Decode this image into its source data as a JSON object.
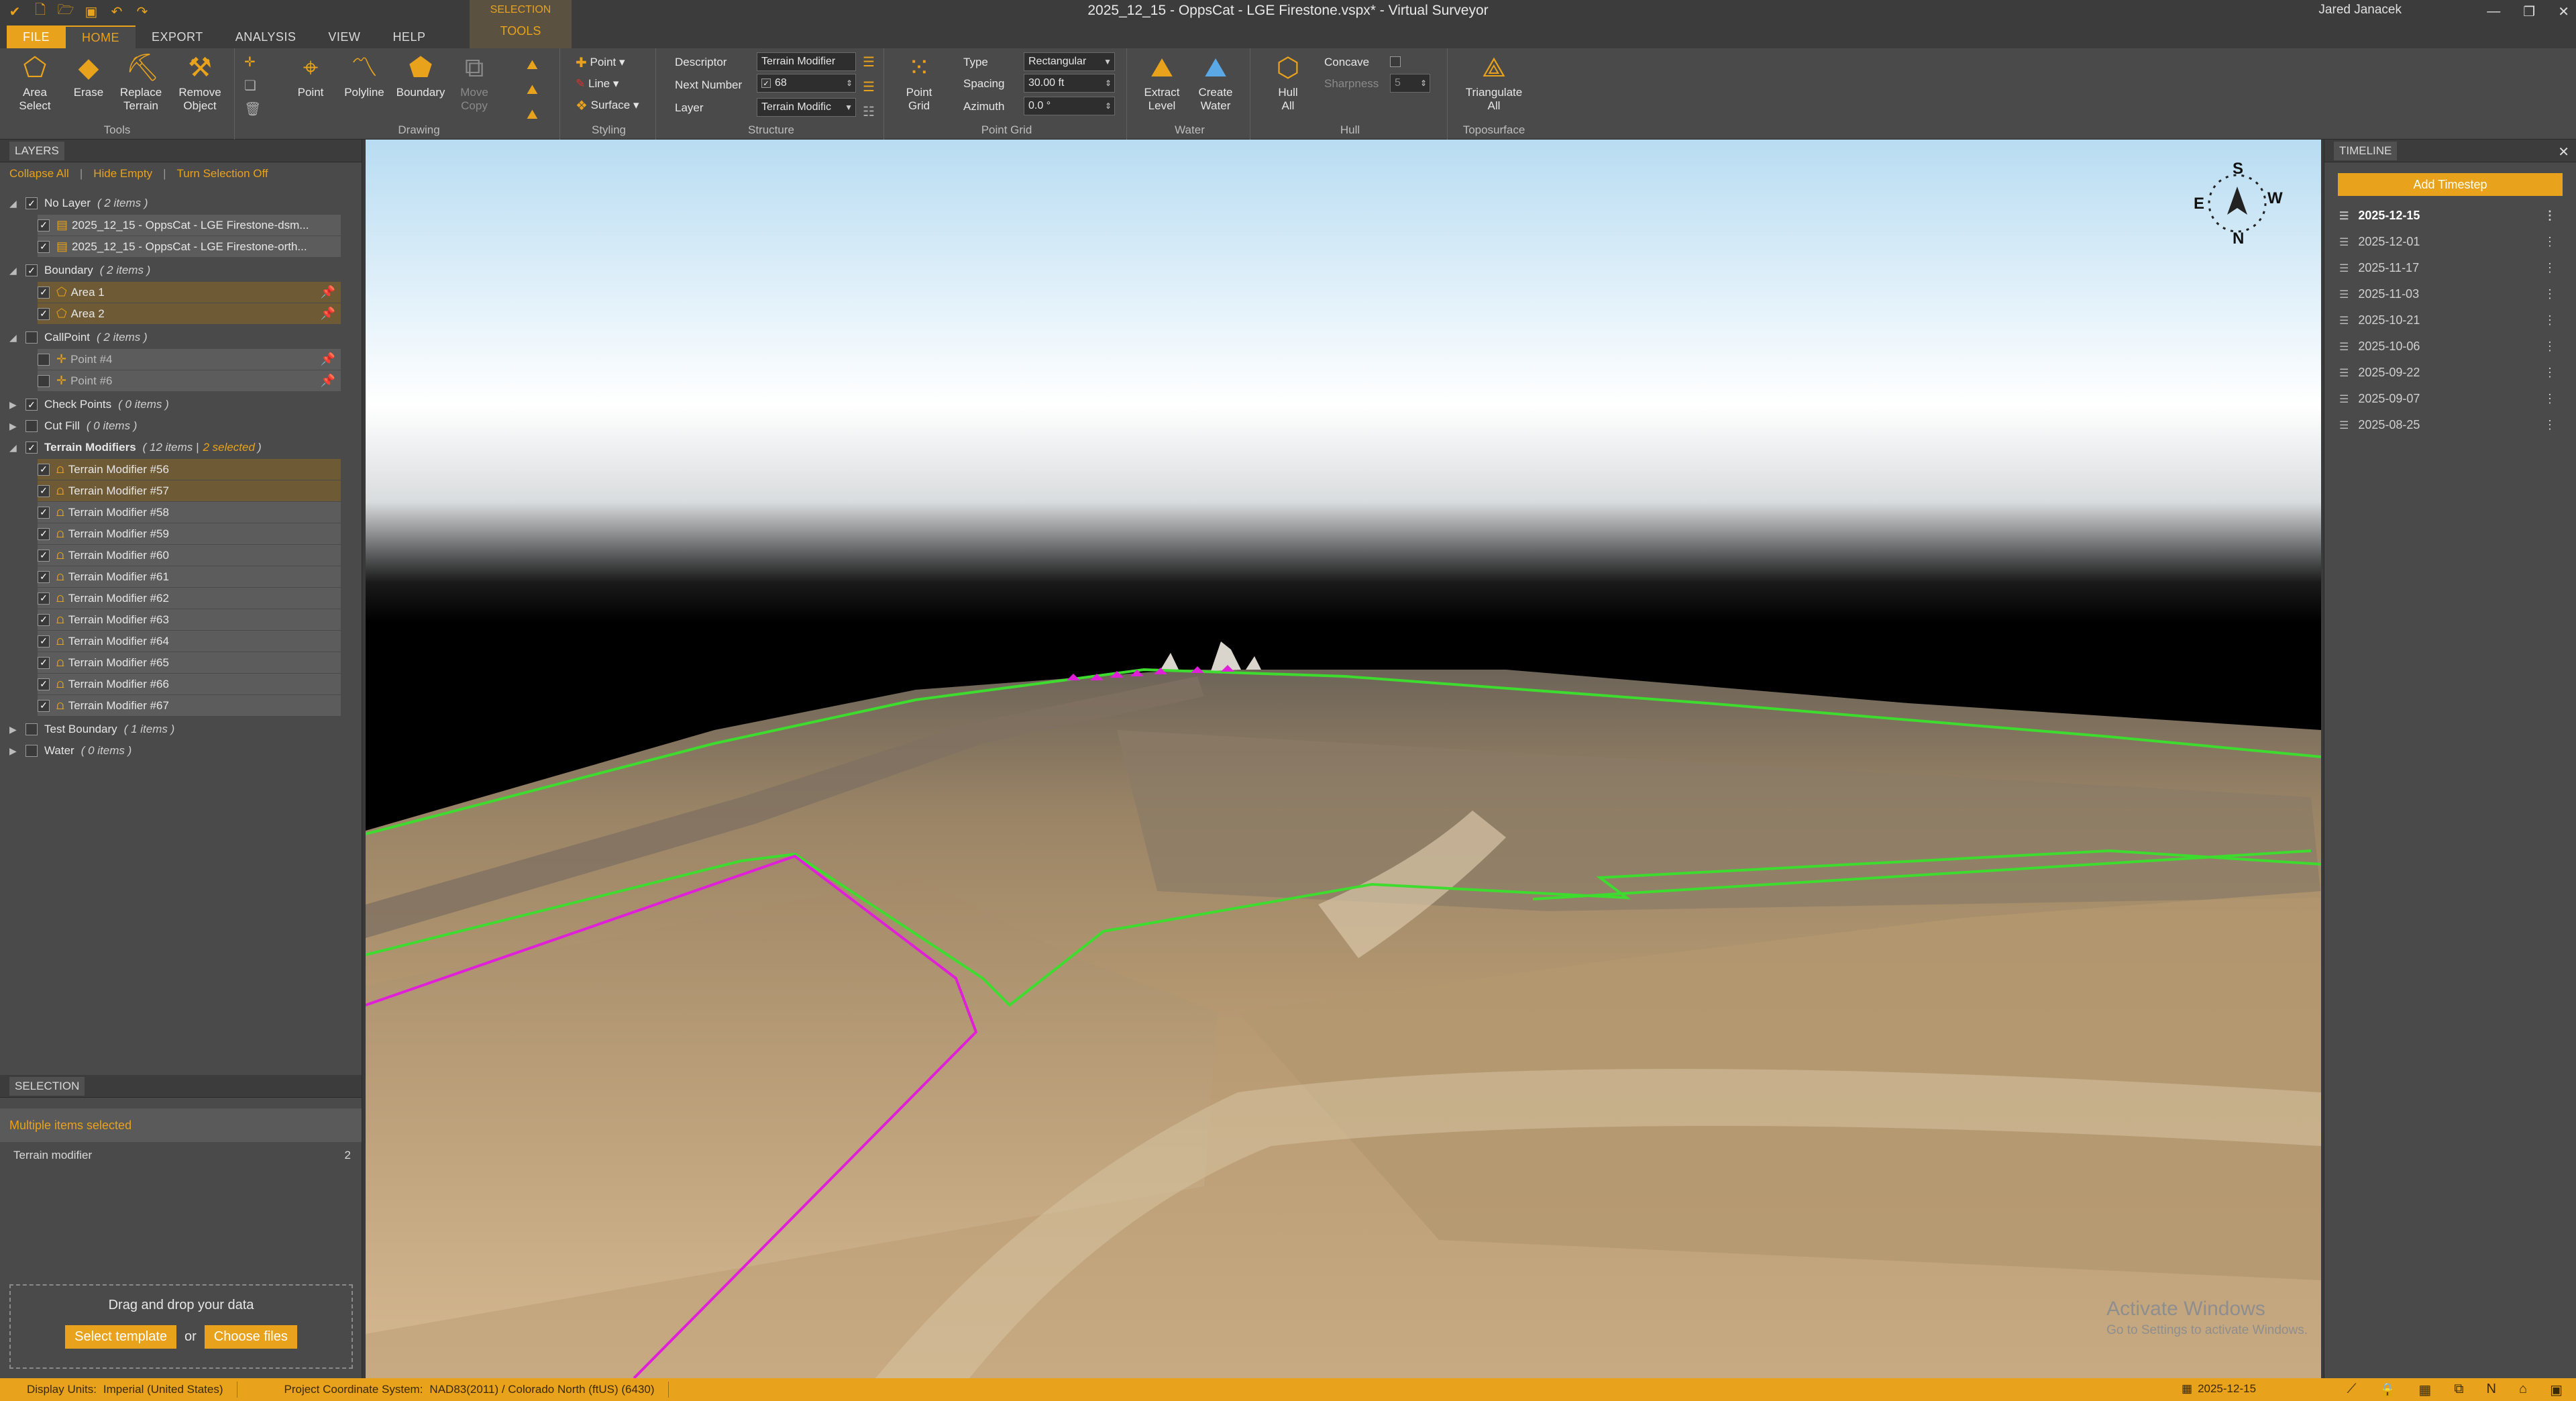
{
  "window": {
    "title": "2025_12_15 - OppsCat - LGE Firestone.vspx* - Virtual Surveyor",
    "user": "Jared Janacek"
  },
  "tabs": {
    "file": "FILE",
    "home": "HOME",
    "export": "EXPORT",
    "analysis": "ANALYSIS",
    "view": "VIEW",
    "help": "HELP",
    "context": "SELECTION",
    "tools": "TOOLS"
  },
  "ribbon": {
    "tools": {
      "label": "Tools",
      "area_select": "Area\nSelect",
      "erase": "Erase",
      "replace_terrain": "Replace\nTerrain",
      "remove_object": "Remove\nObject"
    },
    "drawing": {
      "label": "Drawing",
      "point": "Point",
      "polyline": "Polyline",
      "boundary": "Boundary",
      "move_copy": "Move\nCopy"
    },
    "styling": {
      "label": "Styling",
      "point": "Point",
      "line": "Line",
      "surface": "Surface"
    },
    "structure": {
      "label": "Structure",
      "descriptor_label": "Descriptor",
      "descriptor_value": "Terrain Modifier",
      "next_number_label": "Next Number",
      "next_number_value": "68",
      "layer_label": "Layer",
      "layer_value": "Terrain Modific"
    },
    "point_grid": {
      "label": "Point Grid",
      "button": "Point\nGrid",
      "type_label": "Type",
      "type_value": "Rectangular",
      "spacing_label": "Spacing",
      "spacing_value": "30.00 ft",
      "azimuth_label": "Azimuth",
      "azimuth_value": "0.0 °"
    },
    "water": {
      "label": "Water",
      "extract_level": "Extract\nLevel",
      "create_water": "Create\nWater"
    },
    "hull": {
      "label": "Hull",
      "hull_all": "Hull\nAll",
      "concave_label": "Concave",
      "sharpness_label": "Sharpness",
      "sharpness_value": "5"
    },
    "toposurface": {
      "label": "Toposurface",
      "triangulate_all": "Triangulate\nAll"
    }
  },
  "layers": {
    "header": "LAYERS",
    "collapse_all": "Collapse All",
    "hide_empty": "Hide Empty",
    "turn_selection_off": "Turn Selection Off",
    "groups": {
      "no_layer": {
        "name": "No Layer",
        "count": "( 2 items )"
      },
      "boundary": {
        "name": "Boundary",
        "count": "( 2 items )"
      },
      "callpoint": {
        "name": "CallPoint",
        "count": "( 2 items )"
      },
      "check_points": {
        "name": "Check Points",
        "count": "( 0 items )"
      },
      "cut_fill": {
        "name": "Cut Fill",
        "count": "( 0 items )"
      },
      "terrain_modifiers": {
        "name": "Terrain Modifiers",
        "count": "( 12 items |",
        "selected": "2 selected",
        "close": ")"
      },
      "test_boundary": {
        "name": "Test Boundary",
        "count": "( 1 items )"
      },
      "water": {
        "name": "Water",
        "count": "( 0 items )"
      }
    },
    "no_layer_items": [
      "2025_12_15 - OppsCat - LGE Firestone-dsm...",
      "2025_12_15 - OppsCat - LGE Firestone-orth..."
    ],
    "boundary_items": [
      "Area 1",
      "Area 2"
    ],
    "callpoint_items": [
      "Point #4",
      "Point #6"
    ],
    "terrain_items": [
      "Terrain Modifier #56",
      "Terrain Modifier #57",
      "Terrain Modifier #58",
      "Terrain Modifier #59",
      "Terrain Modifier #60",
      "Terrain Modifier #61",
      "Terrain Modifier #62",
      "Terrain Modifier #63",
      "Terrain Modifier #64",
      "Terrain Modifier #65",
      "Terrain Modifier #66",
      "Terrain Modifier #67"
    ]
  },
  "selection": {
    "header": "SELECTION",
    "summary": "Multiple items selected",
    "item_label": "Terrain modifier",
    "item_count": "2",
    "drop_text": "Drag and drop your data",
    "select_template": "Select template",
    "or": "or",
    "choose_files": "Choose files"
  },
  "viewport": {
    "compass": {
      "n": "N",
      "s": "S",
      "e": "E",
      "w": "W"
    },
    "activate_title": "Activate Windows",
    "activate_sub": "Go to Settings to activate Windows."
  },
  "timeline": {
    "header": "TIMELINE",
    "add_timestep": "Add Timestep",
    "dates": [
      "2025-12-15",
      "2025-12-01",
      "2025-11-17",
      "2025-11-03",
      "2025-10-21",
      "2025-10-06",
      "2025-09-22",
      "2025-09-07",
      "2025-08-25"
    ]
  },
  "status": {
    "display_units_label": "Display Units:",
    "display_units_value": "Imperial (United States)",
    "pcs_label": "Project Coordinate System:",
    "pcs_value": "NAD83(2011) / Colorado North (ftUS) (6430)",
    "date": "2025-12-15"
  },
  "colors": {
    "accent": "#e8a21b",
    "boundary_line": "#3ddc2e",
    "magenta_line": "#e020d8"
  }
}
